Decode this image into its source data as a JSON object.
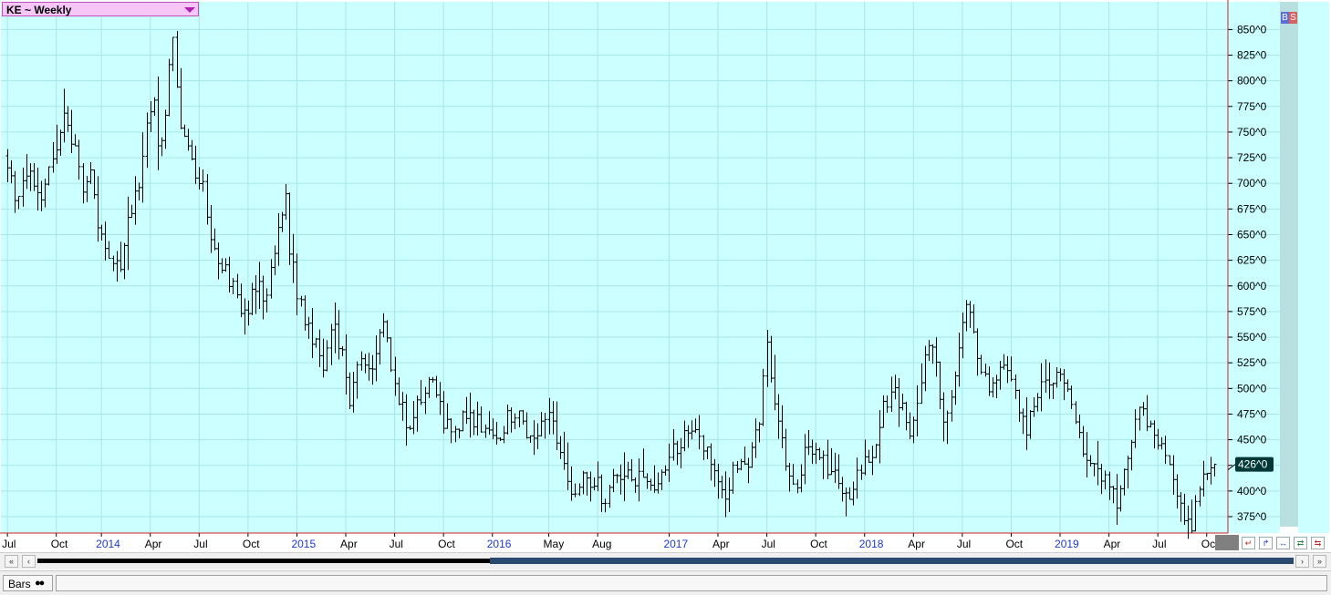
{
  "window": {
    "symbol_label": "KE ~ Weekly",
    "bs_labels": [
      "B",
      "S"
    ]
  },
  "colors": {
    "plot_background": "#ccffff",
    "grid": "#a8e6ea",
    "frame_line": "#d02020",
    "bar": "#000000",
    "date_year": "#1a3cc8",
    "date_month": "#000000",
    "last_price_bg": "#003838",
    "scrollbar_thumb": "#2a4a70"
  },
  "chart_data": {
    "type": "ohlc",
    "price_unit": "cents per bushel (x^y = x and y/8 cents)",
    "timeframe": "Weekly",
    "y_axis": {
      "ticks": [
        850,
        825,
        800,
        775,
        750,
        725,
        700,
        675,
        650,
        625,
        600,
        575,
        550,
        525,
        500,
        475,
        450,
        425,
        400,
        375
      ],
      "tick_labels": [
        "850^0",
        "825^0",
        "800^0",
        "775^0",
        "750^0",
        "725^0",
        "700^0",
        "675^0",
        "650^0",
        "625^0",
        "600^0",
        "575^0",
        "550^0",
        "525^0",
        "500^0",
        "475^0",
        "450^0",
        "425^0",
        "400^0",
        "375^0"
      ],
      "range": [
        359,
        877
      ]
    },
    "x_axis": {
      "labels": [
        "Jul",
        "Oct",
        "2014",
        "Apr",
        "Jul",
        "Oct",
        "2015",
        "Apr",
        "Jul",
        "Oct",
        "2016",
        "May",
        "Aug",
        "2017",
        "Apr",
        "Jul",
        "Oct",
        "2018",
        "Apr",
        "Jul",
        "Oct",
        "2019",
        "Apr",
        "Jul",
        "Oct"
      ],
      "year_labels": [
        "2014",
        "2015",
        "2016",
        "2017",
        "2018",
        "2019"
      ],
      "label_week_index": [
        1,
        14,
        26,
        39,
        52,
        65,
        78,
        91,
        104,
        117,
        130,
        145,
        158,
        177,
        190,
        203,
        216,
        229,
        242,
        255,
        268,
        281,
        294,
        307,
        320
      ],
      "start_week": "2013-06-24",
      "total_weeks": 322
    },
    "last_price": 426,
    "last_price_label": "426^0",
    "grid": true,
    "ohlc": {
      "anchors": [
        [
          0,
          725
        ],
        [
          3,
          690
        ],
        [
          7,
          705
        ],
        [
          10,
          690
        ],
        [
          13,
          725
        ],
        [
          16,
          760
        ],
        [
          19,
          740
        ],
        [
          21,
          700
        ],
        [
          23,
          712
        ],
        [
          25,
          660
        ],
        [
          28,
          625
        ],
        [
          31,
          620
        ],
        [
          33,
          660
        ],
        [
          36,
          700
        ],
        [
          38,
          750
        ],
        [
          40,
          790
        ],
        [
          41,
          730
        ],
        [
          43,
          760
        ],
        [
          44,
          810
        ],
        [
          45,
          840
        ],
        [
          47,
          760
        ],
        [
          49,
          740
        ],
        [
          51,
          705
        ],
        [
          53,
          700
        ],
        [
          55,
          640
        ],
        [
          58,
          620
        ],
        [
          62,
          590
        ],
        [
          64,
          570
        ],
        [
          67,
          600
        ],
        [
          70,
          590
        ],
        [
          73,
          650
        ],
        [
          75,
          690
        ],
        [
          76,
          640
        ],
        [
          78,
          590
        ],
        [
          81,
          560
        ],
        [
          85,
          520
        ],
        [
          88,
          565
        ],
        [
          90,
          530
        ],
        [
          92,
          490
        ],
        [
          95,
          530
        ],
        [
          98,
          515
        ],
        [
          101,
          570
        ],
        [
          103,
          520
        ],
        [
          106,
          480
        ],
        [
          108,
          460
        ],
        [
          111,
          490
        ],
        [
          114,
          510
        ],
        [
          117,
          470
        ],
        [
          120,
          460
        ],
        [
          123,
          475
        ],
        [
          127,
          465
        ],
        [
          131,
          445
        ],
        [
          134,
          470
        ],
        [
          137,
          480
        ],
        [
          140,
          450
        ],
        [
          143,
          465
        ],
        [
          146,
          470
        ],
        [
          150,
          410
        ],
        [
          151,
          400
        ],
        [
          154,
          415
        ],
        [
          158,
          405
        ],
        [
          160,
          385
        ],
        [
          162,
          412
        ],
        [
          165,
          418
        ],
        [
          168,
          410
        ],
        [
          171,
          412
        ],
        [
          173,
          395
        ],
        [
          175,
          410
        ],
        [
          178,
          440
        ],
        [
          181,
          450
        ],
        [
          184,
          460
        ],
        [
          187,
          440
        ],
        [
          190,
          412
        ],
        [
          192,
          400
        ],
        [
          195,
          425
        ],
        [
          198,
          430
        ],
        [
          201,
          470
        ],
        [
          203,
          540
        ],
        [
          205,
          480
        ],
        [
          207,
          450
        ],
        [
          209,
          410
        ],
        [
          211,
          395
        ],
        [
          213,
          440
        ],
        [
          216,
          440
        ],
        [
          219,
          420
        ],
        [
          222,
          410
        ],
        [
          225,
          400
        ],
        [
          228,
          420
        ],
        [
          231,
          435
        ],
        [
          233,
          470
        ],
        [
          236,
          500
        ],
        [
          239,
          485
        ],
        [
          241,
          460
        ],
        [
          244,
          500
        ],
        [
          246,
          550
        ],
        [
          248,
          520
        ],
        [
          250,
          470
        ],
        [
          252,
          500
        ],
        [
          254,
          540
        ],
        [
          256,
          590
        ],
        [
          258,
          560
        ],
        [
          260,
          510
        ],
        [
          263,
          500
        ],
        [
          266,
          520
        ],
        [
          268,
          510
        ],
        [
          270,
          480
        ],
        [
          272,
          460
        ],
        [
          275,
          490
        ],
        [
          277,
          510
        ],
        [
          280,
          515
        ],
        [
          283,
          500
        ],
        [
          285,
          475
        ],
        [
          287,
          440
        ],
        [
          290,
          430
        ],
        [
          293,
          410
        ],
        [
          295,
          395
        ],
        [
          296,
          380
        ],
        [
          298,
          420
        ],
        [
          300,
          450
        ],
        [
          302,
          475
        ],
        [
          304,
          470
        ],
        [
          306,
          450
        ],
        [
          308,
          440
        ],
        [
          310,
          420
        ],
        [
          312,
          400
        ],
        [
          314,
          380
        ],
        [
          316,
          370
        ],
        [
          318,
          400
        ],
        [
          320,
          420
        ],
        [
          322,
          426
        ]
      ],
      "range_scale": 0.9,
      "seed": 20131
    }
  },
  "scrollbar": {
    "left_label": "«",
    "prev_label": "‹",
    "next_label": "›",
    "right_label": "»"
  },
  "status": {
    "bars_label": "Bars",
    "bars_icon": "glasses-icon"
  }
}
